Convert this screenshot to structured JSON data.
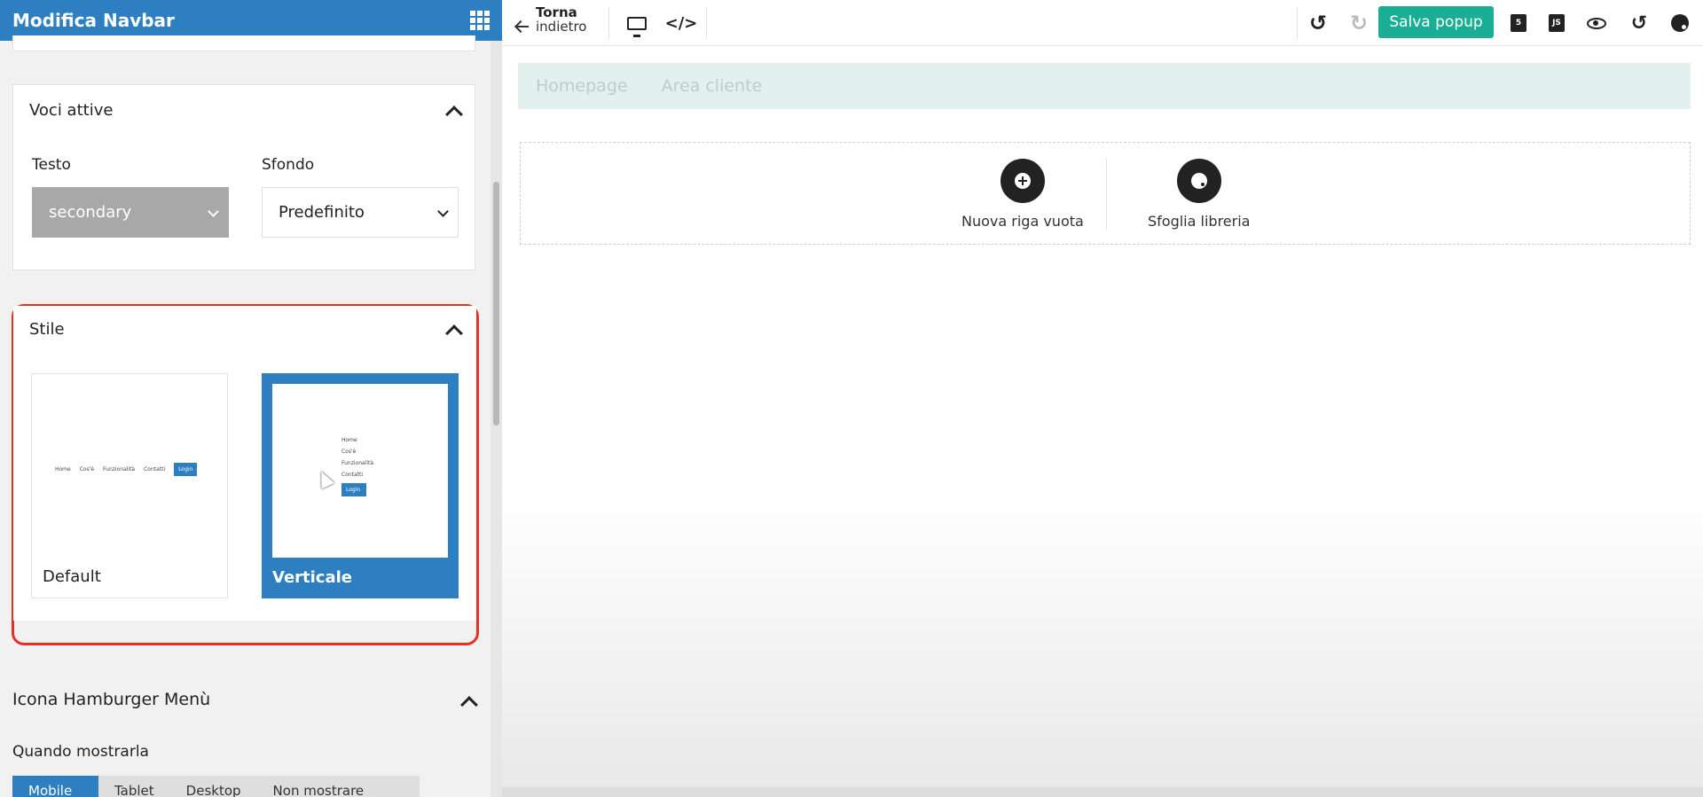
{
  "sidebar": {
    "title": "Modifica Navbar",
    "voci_attive": {
      "heading": "Voci attive",
      "testo_label": "Testo",
      "testo_value": "secondary",
      "sfondo_label": "Sfondo",
      "sfondo_value": "Predefinito"
    },
    "stile": {
      "heading": "Stile",
      "cards": [
        {
          "label": "Default",
          "preview_items": [
            "Home",
            "Cos'è",
            "Funzionalità",
            "Contatti"
          ],
          "preview_button": "Login"
        },
        {
          "label": "Verticale",
          "preview_items": [
            "Home",
            "Cos'è",
            "Funzionalità",
            "Contatti"
          ],
          "preview_button": "Login",
          "selected": true
        }
      ]
    },
    "hamburger": {
      "heading": "Icona Hamburger Menù",
      "when_label": "Quando mostrarla",
      "devices": [
        "Mobile",
        "Tablet",
        "Desktop",
        "Non mostrare"
      ]
    }
  },
  "toolbar": {
    "back_line1": "Torna",
    "back_line2": "indietro",
    "save_label": "Salva popup",
    "css_badge": "5",
    "js_badge": "JS"
  },
  "canvas": {
    "nav_links": [
      "Homepage",
      "Area cliente"
    ],
    "actions": {
      "new_row": "Nuova riga vuota",
      "browse_library": "Sfoglia libreria"
    }
  },
  "colors": {
    "brand": "#2e7fc1",
    "save": "#1aaf94",
    "highlight": "#e53222"
  }
}
